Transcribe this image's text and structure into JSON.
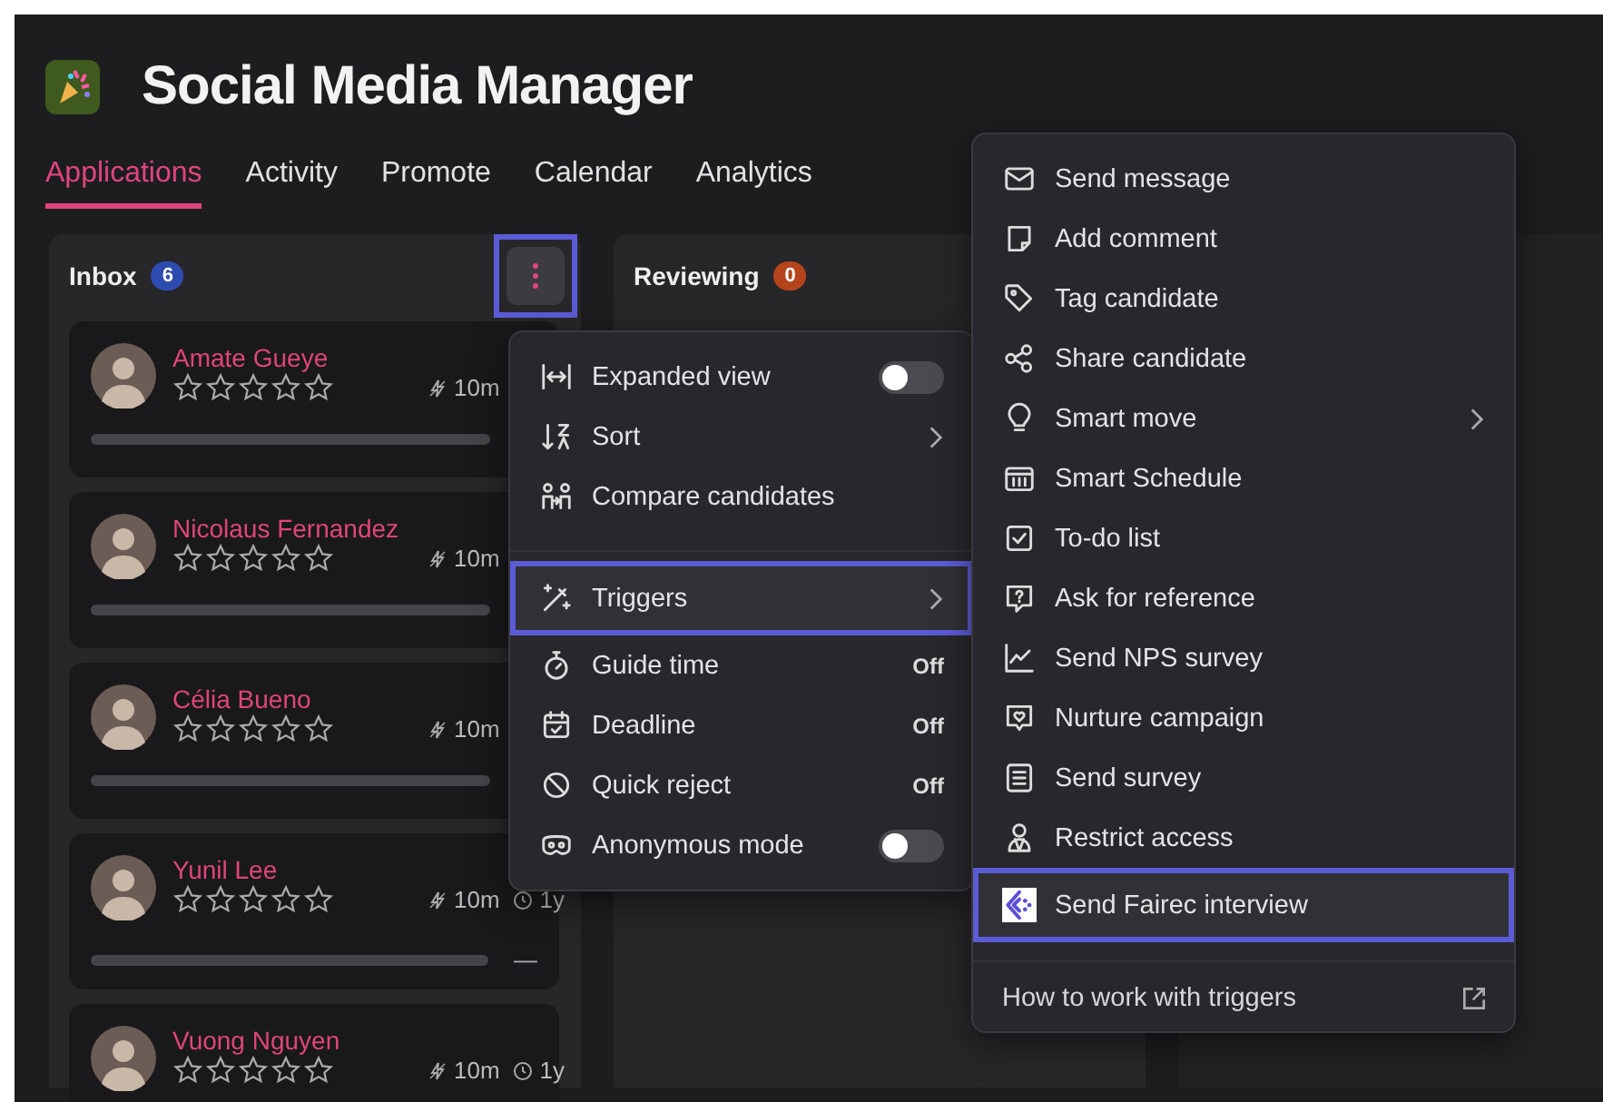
{
  "app": {
    "title": "Social Media Manager"
  },
  "tabs": [
    {
      "label": "Applications",
      "selected": true
    },
    {
      "label": "Activity",
      "selected": false
    },
    {
      "label": "Promote",
      "selected": false
    },
    {
      "label": "Calendar",
      "selected": false
    },
    {
      "label": "Analytics",
      "selected": false
    }
  ],
  "columns": [
    {
      "title": "Inbox",
      "count": "6",
      "color": "#2e4bb0",
      "menu_button": {
        "highlighted": true
      }
    },
    {
      "title": "Reviewing",
      "count": "0",
      "color": "#b5441c"
    }
  ],
  "candidates": [
    {
      "name": "Amate Gueye",
      "stars": 0,
      "time": "10m"
    },
    {
      "name": "Nicolaus Fernandez",
      "stars": 0,
      "time": "10m"
    },
    {
      "name": "Célia Bueno",
      "stars": 0,
      "time": "10m"
    },
    {
      "name": "Yunil Lee",
      "stars": 0,
      "time": "10m",
      "age": "1y",
      "trailing": "—"
    },
    {
      "name": "Vuong Nguyen",
      "stars": 0,
      "time": "10m",
      "age": "1y"
    }
  ],
  "column_menu": [
    {
      "label": "Expanded view",
      "kind": "toggle",
      "on": false,
      "highlighted": false
    },
    {
      "label": "Sort",
      "kind": "submenu",
      "highlighted": false
    },
    {
      "label": "Compare candidates",
      "kind": "action",
      "highlighted": false
    },
    {
      "label": "Triggers",
      "kind": "submenu",
      "highlighted": true
    },
    {
      "label": "Guide time",
      "kind": "status",
      "value": "Off",
      "highlighted": false
    },
    {
      "label": "Deadline",
      "kind": "status",
      "value": "Off",
      "highlighted": false
    },
    {
      "label": "Quick reject",
      "kind": "status",
      "value": "Off",
      "highlighted": false
    },
    {
      "label": "Anonymous mode",
      "kind": "toggle",
      "on": false,
      "highlighted": false
    }
  ],
  "triggers_menu": {
    "items": [
      {
        "label": "Send message",
        "kind": "action",
        "highlighted": false
      },
      {
        "label": "Add comment",
        "kind": "action",
        "highlighted": false
      },
      {
        "label": "Tag candidate",
        "kind": "action",
        "highlighted": false
      },
      {
        "label": "Share candidate",
        "kind": "action",
        "highlighted": false
      },
      {
        "label": "Smart move",
        "kind": "submenu",
        "highlighted": false
      },
      {
        "label": "Smart Schedule",
        "kind": "action",
        "highlighted": false
      },
      {
        "label": "To-do list",
        "kind": "action",
        "highlighted": false
      },
      {
        "label": "Ask for reference",
        "kind": "action",
        "highlighted": false
      },
      {
        "label": "Send NPS survey",
        "kind": "action",
        "highlighted": false
      },
      {
        "label": "Nurture campaign",
        "kind": "action",
        "highlighted": false
      },
      {
        "label": "Send survey",
        "kind": "action",
        "highlighted": false
      },
      {
        "label": "Restrict access",
        "kind": "action",
        "highlighted": false
      },
      {
        "label": "Send Fairec interview",
        "kind": "action",
        "highlighted": true
      }
    ],
    "footer_link": "How to work with triggers"
  }
}
